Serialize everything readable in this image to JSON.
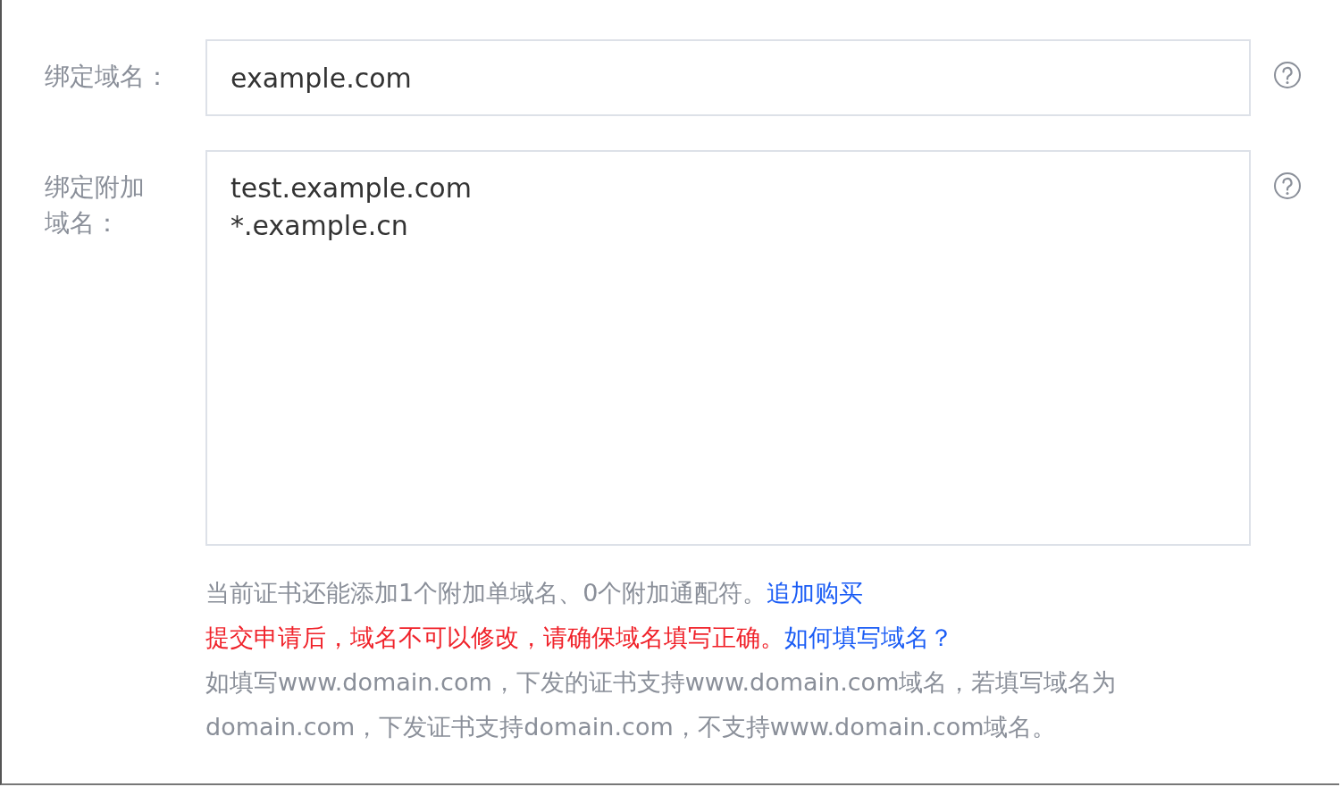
{
  "fields": [
    {
      "label": "绑定域名：",
      "kind": "input",
      "value": "example.com"
    },
    {
      "label": "绑定附加域名：",
      "kind": "textarea",
      "value": "test.example.com\n*.example.cn"
    }
  ],
  "notes": [
    {
      "kind": "info",
      "text": "当前证书还能添加1个附加单域名、0个附加通配符。",
      "link": "追加购买"
    },
    {
      "kind": "warning",
      "text": "提交申请后，域名不可以修改，请确保域名填写正确。",
      "link": "如何填写域名？"
    },
    {
      "kind": "info",
      "text": "如填写www.domain.com，下发的证书支持www.domain.com域名，若填写域名为domain.com，下发证书支持domain.com，不支持www.domain.com域名。"
    }
  ]
}
